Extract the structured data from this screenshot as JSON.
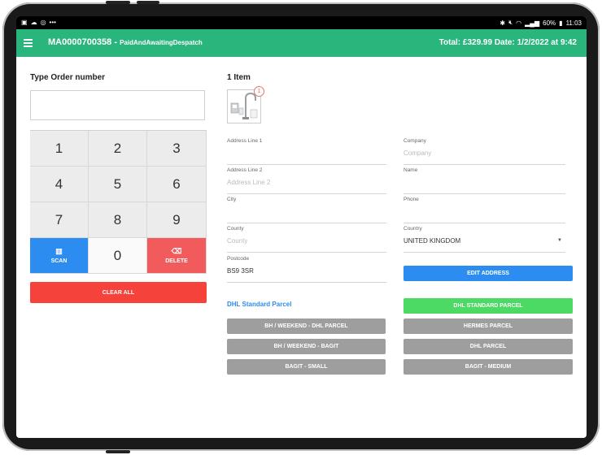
{
  "status_bar": {
    "left_icons": [
      "image-icon",
      "cloud-icon",
      "sync-icon",
      "more-icon"
    ],
    "bluetooth": "✱",
    "battery": "60%",
    "time": "11:03"
  },
  "app_bar": {
    "order_number": "MA0000700358",
    "separator": " - ",
    "order_status": "PaidAndAwaitingDespatch",
    "totals": "Total: £329.99 Date: 1/2/2022 at 9:42",
    "color": "#2ab57d"
  },
  "order_entry": {
    "heading": "Type Order number",
    "value": ""
  },
  "keypad": {
    "keys": [
      "1",
      "2",
      "3",
      "4",
      "5",
      "6",
      "7",
      "8",
      "9"
    ],
    "scan_label": "SCAN",
    "zero_label": "0",
    "delete_label": "DELETE",
    "clear_all_label": "CLEAR ALL"
  },
  "items": {
    "heading": "1 Item",
    "badge_count": "1"
  },
  "address": {
    "line1": {
      "label": "Address Line 1",
      "value": ""
    },
    "line2": {
      "label": "Address Line 2",
      "placeholder": "Address Line 2"
    },
    "city": {
      "label": "City",
      "value": ""
    },
    "county": {
      "label": "County",
      "placeholder": "County"
    },
    "postcode": {
      "label": "Postcode",
      "value": "BS9 3SR"
    },
    "company": {
      "label": "Company",
      "placeholder": "Company"
    },
    "name": {
      "label": "Name",
      "value": ""
    },
    "phone": {
      "label": "Phone",
      "value": ""
    },
    "country": {
      "label": "Country",
      "value": "UNITED KINGDOM"
    }
  },
  "edit_address_label": "EDIT ADDRESS",
  "shipping": {
    "selected_service": "DHL Standard Parcel",
    "services_left": [
      "BH / WEEKEND - DHL PARCEL",
      "BH / WEEKEND - BAGIT",
      "BAGIT - SMALL"
    ],
    "services_right": [
      "DHL STANDARD PARCEL",
      "HERMES PARCEL",
      "DHL PARCEL",
      "BAGIT - MEDIUM"
    ],
    "highlight_color": "#4cd964"
  }
}
